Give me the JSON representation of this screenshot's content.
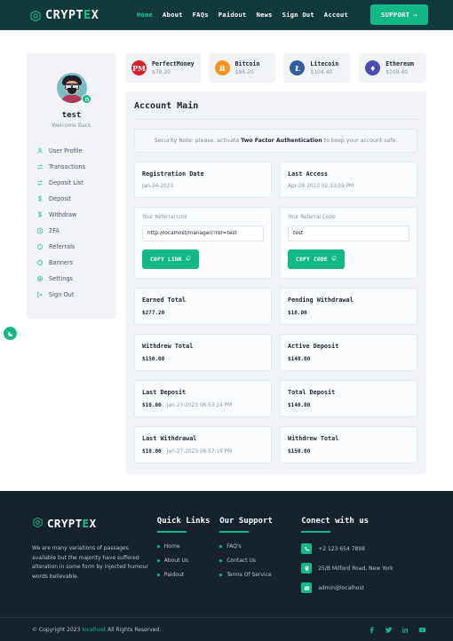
{
  "header": {
    "brand": {
      "name_prefix": "CRYPT",
      "name_accent": "E",
      "name_suffix": "X",
      "logo_icon": "hexagon-c-icon"
    },
    "nav": [
      {
        "label": "Home",
        "active": true
      },
      {
        "label": "About",
        "active": false
      },
      {
        "label": "FAQs",
        "active": false
      },
      {
        "label": "Paidout",
        "active": false
      },
      {
        "label": "News",
        "active": false
      },
      {
        "label": "Sign Out",
        "active": false
      },
      {
        "label": "Accout",
        "active": false
      }
    ],
    "support_label": "SUPPORT",
    "support_arrow": "→"
  },
  "theme_toggle": {
    "icon": "moon-icon"
  },
  "sidebar": {
    "username": "test",
    "welcome": "Welcome Back",
    "avatar_badge_icon": "camera-icon",
    "items": [
      {
        "label": "User Profile",
        "icon": "user-icon"
      },
      {
        "label": "Transactions",
        "icon": "exchange-icon"
      },
      {
        "label": "Deposit List",
        "icon": "exchange-icon"
      },
      {
        "label": "Deposit",
        "icon": "dollar-icon"
      },
      {
        "label": "Withdraw",
        "icon": "dollar-icon"
      },
      {
        "label": "2FA",
        "icon": "shield-clock-icon"
      },
      {
        "label": "Referrals",
        "icon": "circle-icon"
      },
      {
        "label": "Banners",
        "icon": "circle-icon"
      },
      {
        "label": "Settings",
        "icon": "gear-icon"
      },
      {
        "label": "Sign Out",
        "icon": "logout-icon"
      }
    ]
  },
  "crypto": [
    {
      "name": "PerfectMoney",
      "price": "$79.20",
      "symbol": "PM",
      "color": "#d9202a"
    },
    {
      "name": "Bitcoin",
      "price": "$84.20",
      "symbol": "Ƀ",
      "color": "#f7931a"
    },
    {
      "name": "Litecoin",
      "price": "$104.40",
      "symbol": "Ł",
      "color": "#345d9d"
    },
    {
      "name": "Ethereum",
      "price": "$109.40",
      "symbol": "♦",
      "color": "#4b4bb5"
    }
  ],
  "main": {
    "title": "Account Main",
    "notice": {
      "prefix": "Security Note: please, activate ",
      "bold": "Two Factor Authentication",
      "suffix": " to keep your account safe."
    },
    "dates": [
      {
        "label": "Registration Date",
        "value": "Jan-24-2023"
      },
      {
        "label": "Last Access",
        "value": "Apr-28-2023 02:33:59 PM"
      }
    ],
    "referral_link": {
      "label": "Your Referral Link",
      "value": "http://localhost/manager/?ref=test",
      "button": "COPY LINK",
      "button_icon": "copy-icon"
    },
    "referral_code": {
      "label": "Your Referral Code",
      "value": "test",
      "button": "COPY CODE",
      "button_icon": "copy-icon"
    },
    "stats": [
      {
        "label": "Earned Total",
        "amount": "$277.20",
        "when": ""
      },
      {
        "label": "Pending Withdrawal",
        "amount": "$10.00",
        "when": ""
      },
      {
        "label": "Withdrew Total",
        "amount": "$150.00",
        "when": ""
      },
      {
        "label": "Active Deposit",
        "amount": "$140.00",
        "when": ""
      },
      {
        "label": "Last Deposit",
        "amount": "$10.00",
        "when": "Jan-27-2023 06:53:24 PM"
      },
      {
        "label": "Total Deposit",
        "amount": "$140.00",
        "when": ""
      },
      {
        "label": "Last Withdrawal",
        "amount": "$10.00",
        "when": "Jan-27-2023 06:57:19 PM"
      },
      {
        "label": "Withdrew Total",
        "amount": "$150.00",
        "when": ""
      }
    ]
  },
  "footer": {
    "brand": {
      "name_prefix": "CRYPT",
      "name_accent": "E",
      "name_suffix": "X",
      "logo_icon": "hexagon-c-icon"
    },
    "about": "We are many variations of passages available but the majority have suffered alteration in some form by injected humour words believable.",
    "quick_links": {
      "heading": "Quick Links",
      "items": [
        "Home",
        "About Us",
        "Paidout"
      ]
    },
    "support": {
      "heading": "Our Support",
      "items": [
        "FAQ's",
        "Contact Us",
        "Terms Of Service"
      ]
    },
    "connect": {
      "heading": "Conect with us",
      "items": [
        {
          "icon": "phone-icon",
          "text": "+2 123 654 7898"
        },
        {
          "icon": "location-pin-icon",
          "text": "25/B Milford Road, New York"
        },
        {
          "icon": "envelope-icon",
          "text": "admin@localhost"
        }
      ]
    },
    "copyright": {
      "prefix": "© Copyright 2023 ",
      "host": "localhost",
      "suffix": " All Rights Reserved."
    },
    "socials": [
      "facebook-icon",
      "twitter-icon",
      "linkedin-icon",
      "youtube-icon"
    ]
  },
  "colors": {
    "brand_green": "#12b886",
    "header_dark": "#11383a",
    "footer_dark": "#16232c",
    "panel_bg": "#f1f3f7"
  }
}
